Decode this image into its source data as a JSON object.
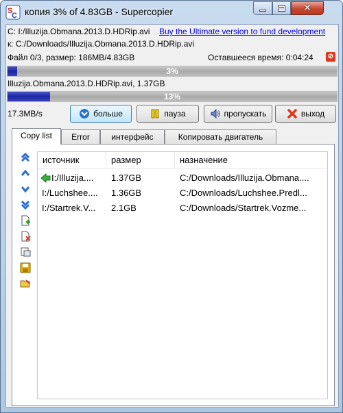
{
  "window": {
    "title": "копия 3% of 4.83GB - Supercopier",
    "minimize_icon": "minimize-icon",
    "maximize_icon": "maximize-icon",
    "close_icon": "close-icon"
  },
  "info": {
    "source_line": "С: I:/Illuzija.Obmana.2013.D.HDRip.avi",
    "ad_link": "Buy the Ultimate version to fund development",
    "dest_line": "к:  C:/Downloads/Illuzija.Obmana.2013.D.HDRip.avi",
    "files_line": "Файл 0/3, размер: 186MB/4.83GB",
    "remaining_label": "Оставшееся время: 0:04:24"
  },
  "progress": {
    "total_percent": 3,
    "total_label": "3%",
    "current_file_line": "Illuzija.Obmana.2013.D.HDRip.avi, 1.37GB",
    "file_percent": 13,
    "file_label": "13%",
    "speed": "17.3MB/s"
  },
  "buttons": {
    "more": "больше",
    "pause": "пауза",
    "skip": "пропускать",
    "exit": "выход"
  },
  "tabs": [
    "Copy list",
    "Error",
    "интерфейс",
    "Копировать двигатель"
  ],
  "list": {
    "columns": [
      "источник",
      "размер",
      "назначение"
    ],
    "rows": [
      {
        "source": "I:/Illuzija....",
        "size": "1.37GB",
        "dest": "C:/Downloads/Illuzija.Obmana...."
      },
      {
        "source": "I:/Luchshee....",
        "size": "1.36GB",
        "dest": "C:/Downloads/Luchshee.Predl..."
      },
      {
        "source": "I:/Startrek.V...",
        "size": "2.1GB",
        "dest": "C:/Downloads/Startrek.Vozme..."
      }
    ]
  },
  "colors": {
    "progress_fill": "#1c25a3",
    "active_arrow": "#2e9c2e",
    "exit_red": "#d9381e"
  }
}
